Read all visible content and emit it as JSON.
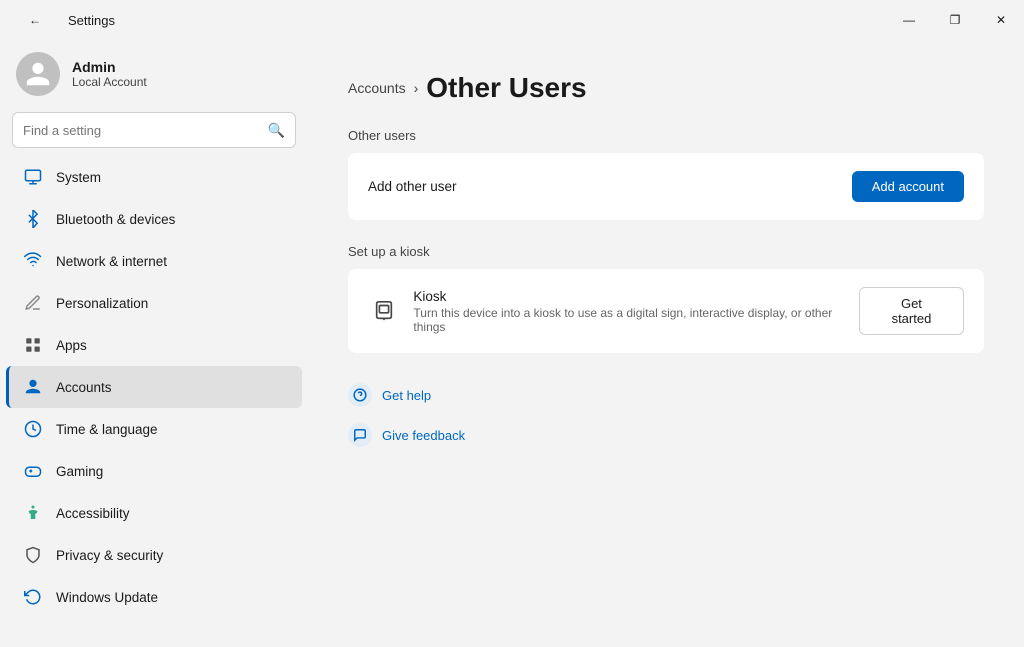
{
  "titlebar": {
    "title": "Settings",
    "back_icon": "←",
    "minimize_label": "—",
    "maximize_label": "❐",
    "close_label": "✕"
  },
  "sidebar": {
    "user": {
      "name": "Admin",
      "type": "Local Account"
    },
    "search": {
      "placeholder": "Find a setting"
    },
    "nav_items": [
      {
        "id": "system",
        "label": "System",
        "icon": "system"
      },
      {
        "id": "bluetooth",
        "label": "Bluetooth & devices",
        "icon": "bluetooth"
      },
      {
        "id": "network",
        "label": "Network & internet",
        "icon": "network"
      },
      {
        "id": "personalization",
        "label": "Personalization",
        "icon": "personalization"
      },
      {
        "id": "apps",
        "label": "Apps",
        "icon": "apps"
      },
      {
        "id": "accounts",
        "label": "Accounts",
        "icon": "accounts",
        "active": true
      },
      {
        "id": "time",
        "label": "Time & language",
        "icon": "time"
      },
      {
        "id": "gaming",
        "label": "Gaming",
        "icon": "gaming"
      },
      {
        "id": "accessibility",
        "label": "Accessibility",
        "icon": "accessibility"
      },
      {
        "id": "privacy",
        "label": "Privacy & security",
        "icon": "privacy"
      },
      {
        "id": "update",
        "label": "Windows Update",
        "icon": "update"
      }
    ]
  },
  "main": {
    "breadcrumb": {
      "parent": "Accounts",
      "arrow": "›",
      "current": "Other Users"
    },
    "other_users": {
      "section_title": "Other users",
      "add_other_user_label": "Add other user",
      "add_account_button": "Add account"
    },
    "kiosk": {
      "section_title": "Set up a kiosk",
      "title": "Kiosk",
      "description": "Turn this device into a kiosk to use as a digital sign, interactive display, or other things",
      "button_label": "Get started"
    },
    "help": {
      "get_help_label": "Get help",
      "give_feedback_label": "Give feedback"
    }
  }
}
